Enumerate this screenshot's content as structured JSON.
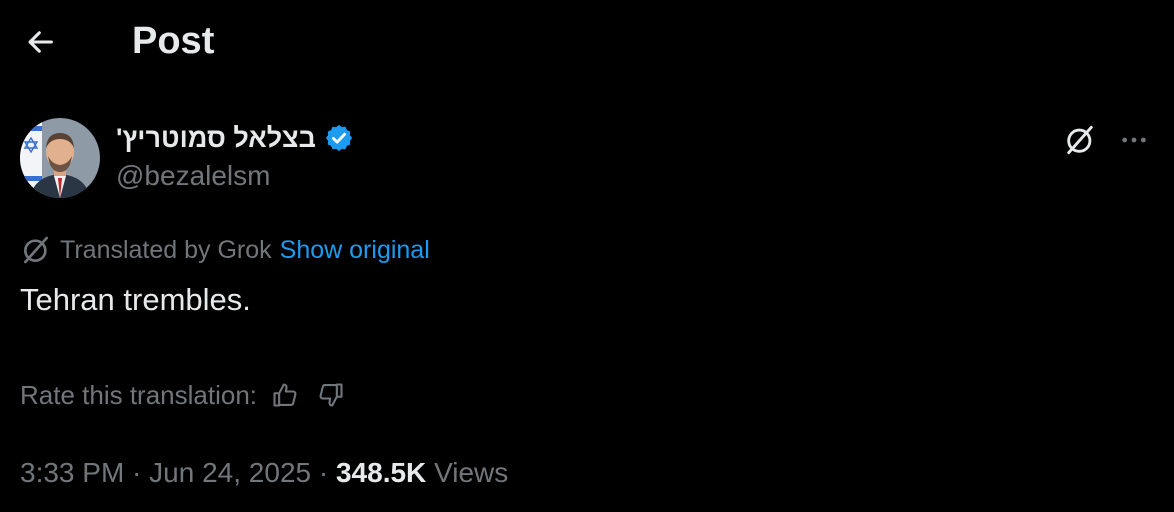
{
  "header": {
    "title": "Post",
    "back_icon": "arrow-left-icon"
  },
  "author": {
    "display_name": "בצלאל סמוטריץ'",
    "handle": "@bezalelsm",
    "verified_icon": "verified-badge-icon",
    "verified_color": "#1d9bf0",
    "avatar": "author-avatar"
  },
  "actions": {
    "grok_icon": "grok-icon",
    "more_icon": "more-dots-icon"
  },
  "translation": {
    "label": "Translated by Grok",
    "show_original": "Show original",
    "link_color": "#1d9bf0"
  },
  "post": {
    "text": "Tehran trembles."
  },
  "rating": {
    "label": "Rate this translation:",
    "thumbs_up_icon": "thumbs-up-icon",
    "thumbs_down_icon": "thumbs-down-icon"
  },
  "meta": {
    "time": "3:33 PM",
    "date": "Jun 24, 2025",
    "separator": " · ",
    "views_count": "348.5K",
    "views_label": "Views"
  },
  "colors": {
    "background": "#000000",
    "primary_text": "#e7e9ea",
    "secondary_text": "#71767b",
    "accent": "#1d9bf0"
  }
}
